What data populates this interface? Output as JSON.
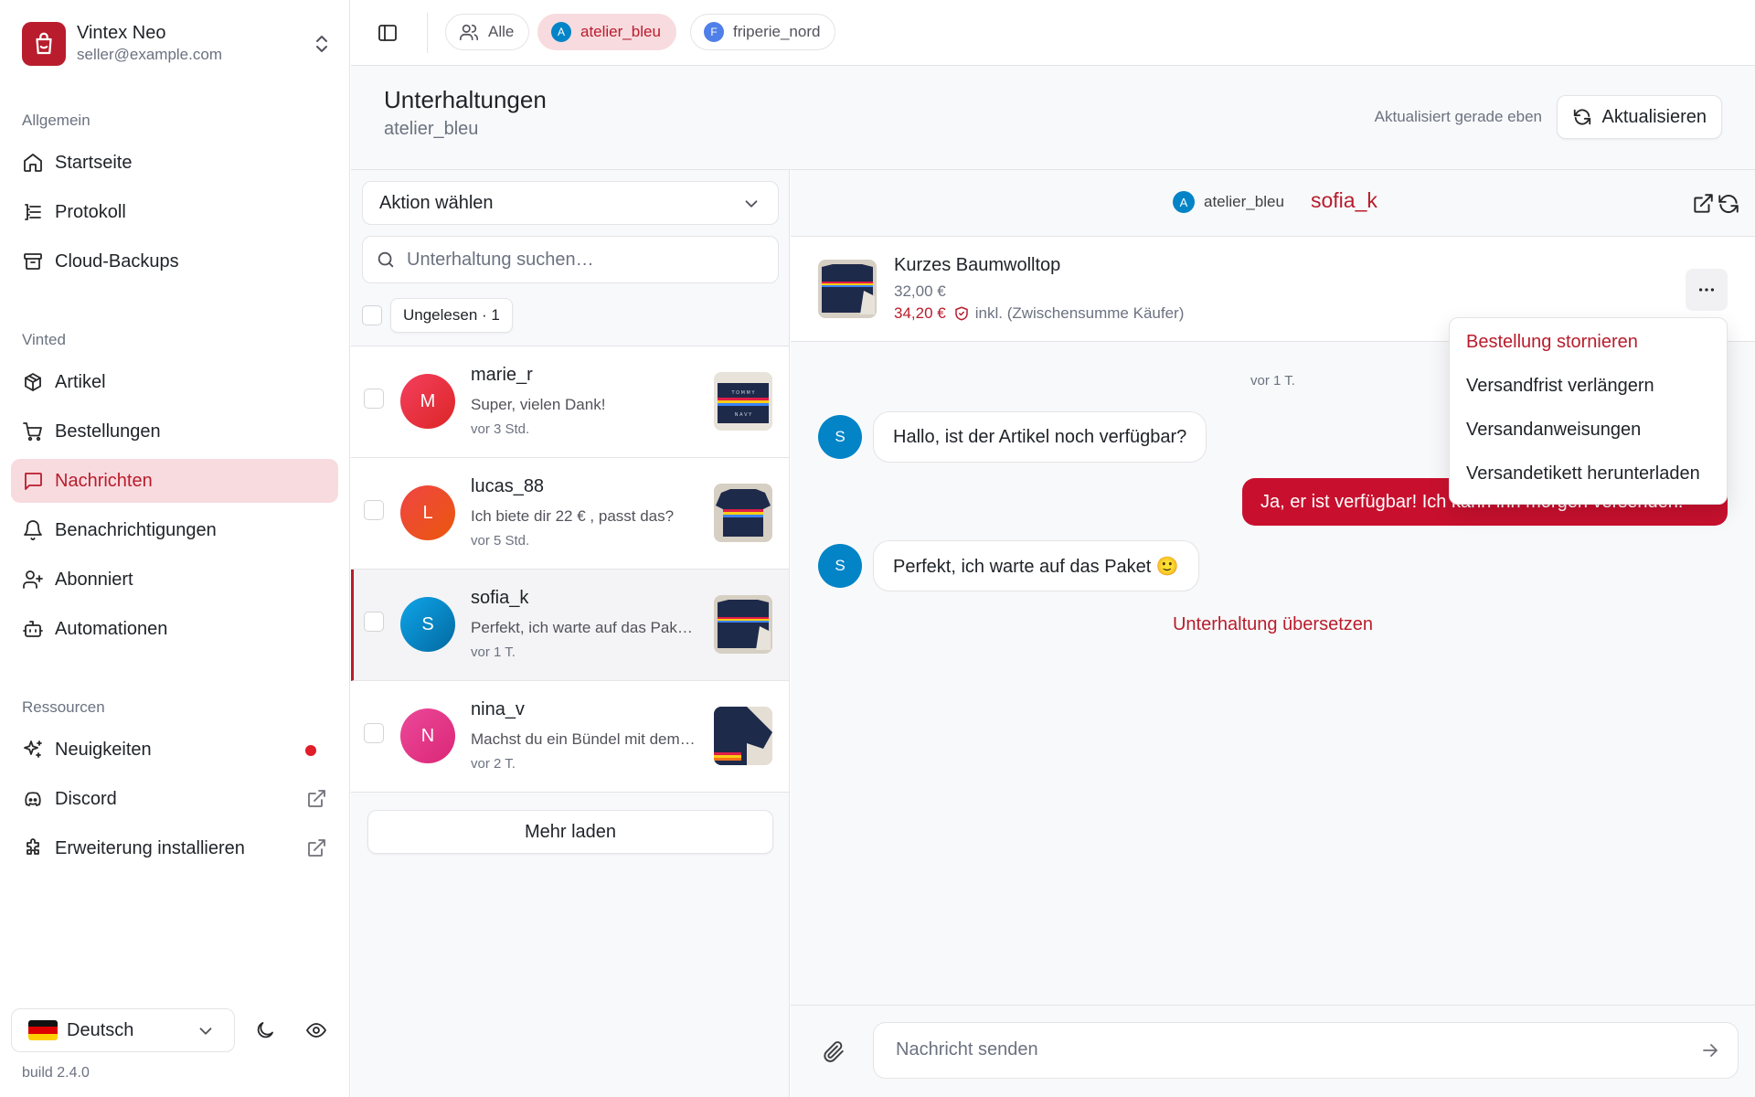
{
  "sidebar": {
    "brand_name": "Vintex Neo",
    "brand_email": "seller@example.com",
    "section_general": "Allgemein",
    "general_items": [
      {
        "label": "Startseite",
        "icon": "home-icon"
      },
      {
        "label": "Protokoll",
        "icon": "log-icon"
      },
      {
        "label": "Cloud-Backups",
        "icon": "archive-icon"
      }
    ],
    "section_vinted": "Vinted",
    "vinted_items": [
      {
        "label": "Artikel",
        "icon": "package-icon"
      },
      {
        "label": "Bestellungen",
        "icon": "cart-icon"
      },
      {
        "label": "Nachrichten",
        "icon": "message-icon",
        "active": true
      },
      {
        "label": "Benachrichtigungen",
        "icon": "bell-icon"
      },
      {
        "label": "Abonniert",
        "icon": "user-plus-icon"
      },
      {
        "label": "Automationen",
        "icon": "bot-icon"
      }
    ],
    "section_resources": "Ressourcen",
    "resource_items": [
      {
        "label": "Neuigkeiten",
        "icon": "sparkles-icon",
        "badge": "red-dot"
      },
      {
        "label": "Discord",
        "icon": "discord-icon",
        "trail": "external-link-icon"
      },
      {
        "label": "Erweiterung installieren",
        "icon": "puzzle-icon",
        "trail": "external-link-icon"
      }
    ],
    "language": "Deutsch",
    "build": "build 2.4.0"
  },
  "topbar": {
    "chips": [
      {
        "label": "Alle",
        "icon": "users-icon"
      },
      {
        "label": "atelier_bleu",
        "avatar": "A",
        "color": "#0284c7",
        "active": true
      },
      {
        "label": "friperie_nord",
        "avatar": "F",
        "color": "#4f7fe8"
      }
    ]
  },
  "header": {
    "title": "Unterhaltungen",
    "subtitle": "atelier_bleu",
    "updated": "Aktualisiert gerade eben",
    "refresh_label": "Aktualisieren"
  },
  "conversations": {
    "action_placeholder": "Aktion wählen",
    "search_placeholder": "Unterhaltung suchen…",
    "unread_filter": "Ungelesen · 1",
    "items": [
      {
        "name": "marie_r",
        "initial": "M",
        "preview": "Super, vielen Dank!",
        "time": "vor 3 Std.",
        "gradient": "linear-gradient(135deg,#f43f5e,#dc2626)"
      },
      {
        "name": "lucas_88",
        "initial": "L",
        "preview": "Ich biete dir 22 € , passt das?",
        "time": "vor 5 Std.",
        "gradient": "linear-gradient(135deg,#ef4444,#ea580c)"
      },
      {
        "name": "sofia_k",
        "initial": "S",
        "preview": "Perfekt, ich warte auf das Paket 🙂",
        "time": "vor 1 T.",
        "gradient": "linear-gradient(135deg,#0ea5e9,#0369a1)",
        "selected": true
      },
      {
        "name": "nina_v",
        "initial": "N",
        "preview": "Machst du ein Bündel mit dem Rock?",
        "time": "vor 2 T.",
        "gradient": "linear-gradient(135deg,#ec4899,#db2777)"
      }
    ],
    "load_more": "Mehr laden"
  },
  "chat": {
    "account": "atelier_bleu",
    "account_initial": "A",
    "user": "sofia_k",
    "product": {
      "title": "Kurzes Baumwolltop",
      "price": "32,00 €",
      "total_price": "34,20 €",
      "total_note": "inkl. (Zwischensumme Käufer)"
    },
    "day_label": "vor 1 T.",
    "messages": [
      {
        "from": "buyer",
        "initial": "S",
        "text": "Hallo, ist der Artikel noch verfügbar?"
      },
      {
        "from": "seller",
        "text": "Ja, er ist verfügbar! Ich kann ihn morgen versenden."
      },
      {
        "from": "buyer",
        "initial": "S",
        "text": "Perfekt, ich warte auf das Paket 🙂"
      }
    ],
    "translate_link": "Unterhaltung übersetzen",
    "menu": [
      {
        "label": "Bestellung stornieren",
        "danger": true
      },
      {
        "label": "Versandfrist verlängern"
      },
      {
        "label": "Versandanweisungen"
      },
      {
        "label": "Versandetikett herunterladen"
      }
    ],
    "composer_placeholder": "Nachricht senden"
  }
}
